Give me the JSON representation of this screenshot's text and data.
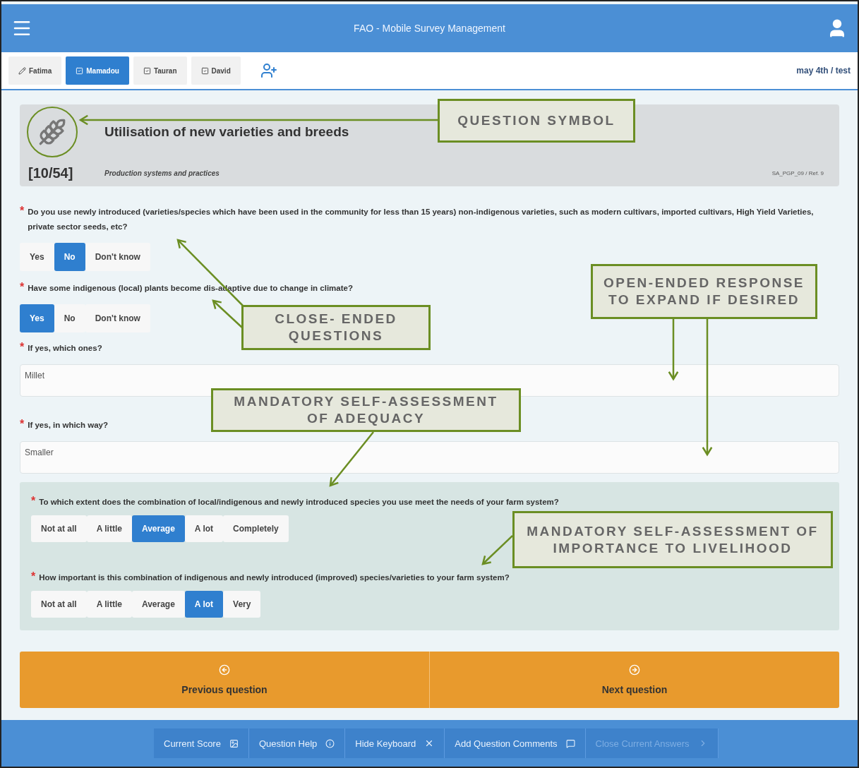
{
  "header": {
    "title": "FAO - Mobile Survey Management"
  },
  "tabs": [
    {
      "label": "Fatima",
      "kind": "edit",
      "selected": false
    },
    {
      "label": "Mamadou",
      "kind": "check",
      "selected": true
    },
    {
      "label": "Tauran",
      "kind": "check",
      "selected": false
    },
    {
      "label": "David",
      "kind": "check",
      "selected": false
    }
  ],
  "session": "may 4th / test",
  "question": {
    "counter": "[10/54]",
    "title": "Utilisation of new varieties and breeds",
    "category": "Production systems and practices",
    "reference": "SA_PGP_09 / Ref. 9"
  },
  "items": [
    {
      "kind": "choice",
      "mark": "*",
      "text": "Do you use newly introduced (varieties/species which have been used in the community for less than 15 years) non-indigenous varieties, such as modern cultivars, imported cultivars, High Yield Varieties, private sector seeds, etc?",
      "options": [
        {
          "label": "Yes",
          "selected": false
        },
        {
          "label": "No",
          "selected": true
        },
        {
          "label": "Don't know",
          "selected": false
        }
      ]
    },
    {
      "kind": "choice",
      "mark": "*",
      "text": "Have some indigenous (local) plants become dis-adaptive due to change in climate?",
      "options": [
        {
          "label": "Yes",
          "selected": true
        },
        {
          "label": "No",
          "selected": false
        },
        {
          "label": "Don't know",
          "selected": false
        }
      ]
    },
    {
      "kind": "text",
      "mark": "*",
      "text": "If yes, which ones?",
      "value": "Millet"
    },
    {
      "kind": "text",
      "mark": "*",
      "text": "If yes, in which way?",
      "value": "Smaller"
    }
  ],
  "assessment": [
    {
      "mark": "*",
      "text": "To which extent does the combination of local/indigenous and newly introduced species you use meet the needs of your farm system?",
      "options": [
        {
          "label": "Not at all",
          "selected": false
        },
        {
          "label": "A little",
          "selected": false
        },
        {
          "label": "Average",
          "selected": true
        },
        {
          "label": "A lot",
          "selected": false
        },
        {
          "label": "Completely",
          "selected": false
        }
      ]
    },
    {
      "mark": "*",
      "text": "How important is this combination of indigenous and newly introduced (improved) species/varieties to your farm system?",
      "options": [
        {
          "label": "Not at all",
          "selected": false
        },
        {
          "label": "A little",
          "selected": false
        },
        {
          "label": "Average",
          "selected": false
        },
        {
          "label": "A lot",
          "selected": true
        },
        {
          "label": "Very",
          "selected": false
        }
      ]
    }
  ],
  "navigation": [
    {
      "kind": "previous",
      "label": "Previous question"
    },
    {
      "kind": "next",
      "label": "Next question"
    }
  ],
  "toolbar": [
    {
      "kind": "score",
      "label": "Current Score",
      "disabled": false
    },
    {
      "kind": "help",
      "label": "Question Help",
      "disabled": false
    },
    {
      "kind": "keyboard",
      "label": "Hide Keyboard",
      "disabled": false
    },
    {
      "kind": "comments",
      "label": "Add Question Comments",
      "disabled": false
    },
    {
      "kind": "close",
      "label": "Close Current Answers",
      "disabled": true
    }
  ],
  "callouts": [
    {
      "text": "QUESTION SYMBOL"
    },
    {
      "text": "CLOSE- ENDED QUESTIONS"
    },
    {
      "text": "OPEN-ENDED RESPONSE TO EXPAND IF DESIRED"
    },
    {
      "text": "MANDATORY SELF-ASSESSMENT OF ADEQUACY"
    },
    {
      "text": "MANDATORY SELF-ASSESSMENT OF IMPORTANCE TO LIVELIHOOD"
    }
  ]
}
